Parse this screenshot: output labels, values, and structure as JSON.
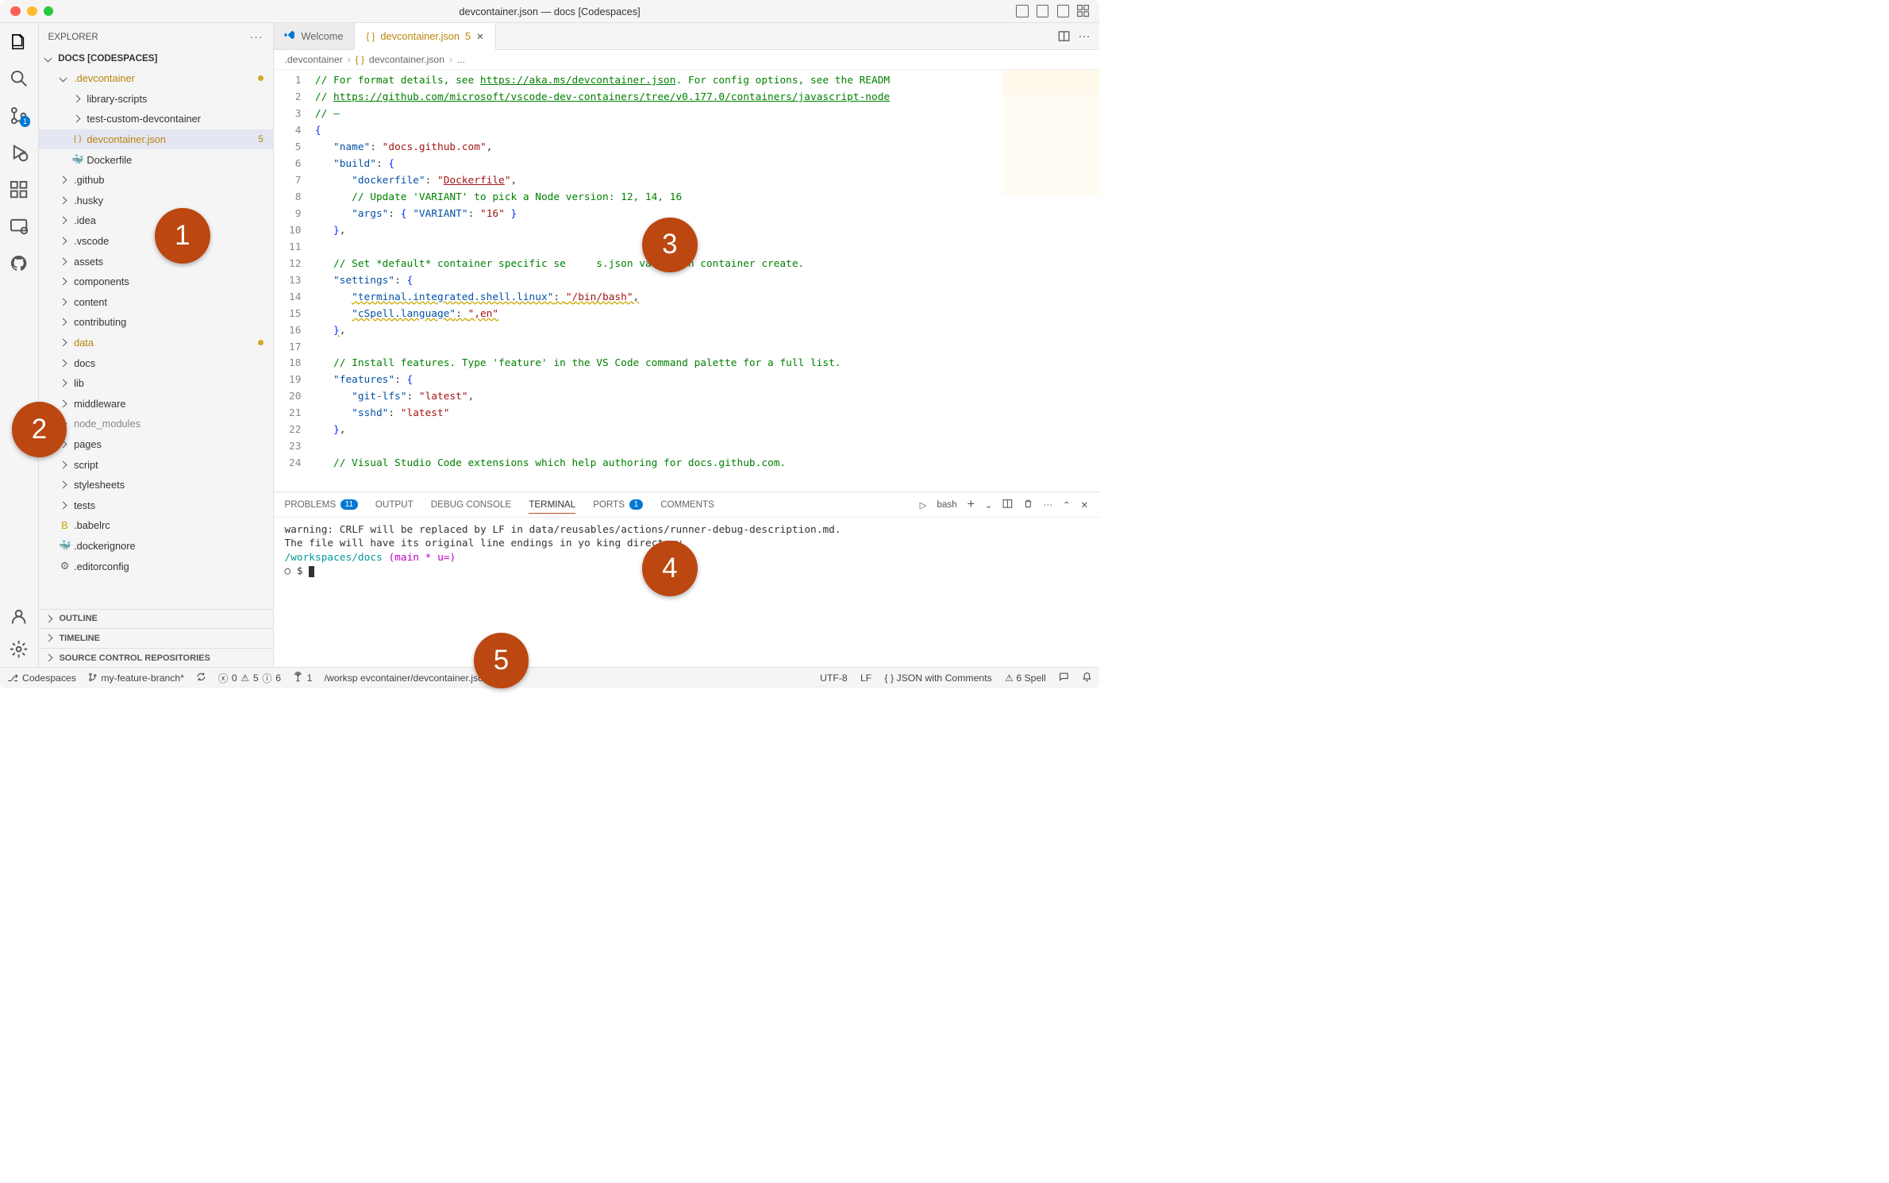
{
  "titlebar": {
    "title": "devcontainer.json — docs [Codespaces]"
  },
  "sidebar": {
    "header": "EXPLORER",
    "workspace": "DOCS [CODESPACES]",
    "tree": [
      {
        "depth": 1,
        "type": "folder-open",
        "label": ".devcontainer",
        "modified": true,
        "dot": true
      },
      {
        "depth": 2,
        "type": "folder",
        "label": "library-scripts"
      },
      {
        "depth": 2,
        "type": "folder",
        "label": "test-custom-devcontainer"
      },
      {
        "depth": 2,
        "type": "json",
        "label": "devcontainer.json",
        "modified": true,
        "selected": true,
        "badge": "5"
      },
      {
        "depth": 2,
        "type": "docker",
        "label": "Dockerfile"
      },
      {
        "depth": 1,
        "type": "folder",
        "label": ".github"
      },
      {
        "depth": 1,
        "type": "folder",
        "label": ".husky"
      },
      {
        "depth": 1,
        "type": "folder",
        "label": ".idea"
      },
      {
        "depth": 1,
        "type": "folder",
        "label": ".vscode"
      },
      {
        "depth": 1,
        "type": "folder",
        "label": "assets"
      },
      {
        "depth": 1,
        "type": "folder",
        "label": "components"
      },
      {
        "depth": 1,
        "type": "folder",
        "label": "content"
      },
      {
        "depth": 1,
        "type": "folder",
        "label": "contributing"
      },
      {
        "depth": 1,
        "type": "folder",
        "label": "data",
        "modified": true,
        "dot": true
      },
      {
        "depth": 1,
        "type": "folder",
        "label": "docs"
      },
      {
        "depth": 1,
        "type": "folder",
        "label": "lib"
      },
      {
        "depth": 1,
        "type": "folder",
        "label": "middleware"
      },
      {
        "depth": 1,
        "type": "folder",
        "label": "node_modules",
        "dimmed": true
      },
      {
        "depth": 1,
        "type": "folder",
        "label": "pages"
      },
      {
        "depth": 1,
        "type": "folder",
        "label": "script"
      },
      {
        "depth": 1,
        "type": "folder",
        "label": "stylesheets"
      },
      {
        "depth": 1,
        "type": "folder",
        "label": "tests"
      },
      {
        "depth": 1,
        "type": "babel",
        "label": ".babelrc"
      },
      {
        "depth": 1,
        "type": "docker",
        "label": ".dockerignore"
      },
      {
        "depth": 1,
        "type": "file",
        "label": ".editorconfig"
      }
    ],
    "panels": [
      "OUTLINE",
      "TIMELINE",
      "SOURCE CONTROL REPOSITORIES"
    ]
  },
  "tabs": {
    "items": [
      {
        "icon": "vscode",
        "label": "Welcome",
        "active": false
      },
      {
        "icon": "json",
        "label": "devcontainer.json",
        "badge": "5",
        "active": true,
        "close": true
      }
    ]
  },
  "breadcrumbs": {
    "items": [
      ".devcontainer",
      "devcontainer.json",
      "..."
    ]
  },
  "editor": {
    "lines": [
      {
        "n": 1,
        "html": "<span class='c-comment'>// For format details, see <span class='c-link'>https://aka.ms/devcontainer.json</span>. For config options, see the READM</span>"
      },
      {
        "n": 2,
        "html": "<span class='c-comment'>// <span class='c-link'>https://github.com/microsoft/vscode-dev-containers/tree/v0.177.0/containers/javascript-node</span></span>"
      },
      {
        "n": 3,
        "html": "<span class='c-comment'>// —</span>"
      },
      {
        "n": 4,
        "html": "<span class='c-brace'>{</span>"
      },
      {
        "n": 5,
        "html": "   <span class='c-key'>\"name\"</span>: <span class='c-string'>\"docs.github.com\"</span>,"
      },
      {
        "n": 6,
        "html": "   <span class='c-key'>\"build\"</span>: <span class='c-brace'>{</span>"
      },
      {
        "n": 7,
        "html": "      <span class='c-key'>\"dockerfile\"</span>: <span class='c-string'>\"<u>Dockerfile</u>\"</span>,"
      },
      {
        "n": 8,
        "html": "      <span class='c-comment'>// Update 'VARIANT' to pick a Node version: 12, 14, 16</span>"
      },
      {
        "n": 9,
        "html": "      <span class='c-key'>\"args\"</span>: <span class='c-brace'>{</span> <span class='c-key'>\"VARIANT\"</span>: <span class='c-string'>\"16\"</span> <span class='c-brace'>}</span>"
      },
      {
        "n": 10,
        "html": "   <span class='c-brace'>}</span>,"
      },
      {
        "n": 11,
        "html": ""
      },
      {
        "n": 12,
        "html": "   <span class='c-comment'>// Set *default* container specific se     s.json values on container create.</span>"
      },
      {
        "n": 13,
        "html": "   <span class='c-key'>\"settings\"</span>: <span class='c-brace'>{</span>"
      },
      {
        "n": 14,
        "html": "      <span class='wavy'><span class='c-key'>\"terminal.integrated.shell.linux\"</span>: <span class='c-string'>\"/bin/bash\"</span>,</span>"
      },
      {
        "n": 15,
        "html": "      <span class='wavy'><span class='c-key'>\"cSpell.language\"</span>: <span class='c-string'>\",en\"</span></span>"
      },
      {
        "n": 16,
        "html": "   <span class='c-brace wavy'>}</span>,"
      },
      {
        "n": 17,
        "html": ""
      },
      {
        "n": 18,
        "html": "   <span class='c-comment'>// Install features. Type 'feature' in the VS Code command palette for a full list.</span>"
      },
      {
        "n": 19,
        "html": "   <span class='c-key'>\"features\"</span>: <span class='c-brace'>{</span>"
      },
      {
        "n": 20,
        "html": "      <span class='c-key'>\"git-lfs\"</span>: <span class='c-string'>\"latest\"</span>,"
      },
      {
        "n": 21,
        "html": "      <span class='c-key'>\"sshd\"</span>: <span class='c-string'>\"latest\"</span>"
      },
      {
        "n": 22,
        "html": "   <span class='c-brace'>}</span>,"
      },
      {
        "n": 23,
        "html": ""
      },
      {
        "n": 24,
        "html": "   <span class='c-comment'>// Visual Studio Code extensions which help authoring for docs.github.com.</span>"
      }
    ]
  },
  "panel": {
    "tabs": {
      "problems": {
        "label": "PROBLEMS",
        "count": "11"
      },
      "output": {
        "label": "OUTPUT"
      },
      "debug": {
        "label": "DEBUG CONSOLE"
      },
      "terminal": {
        "label": "TERMINAL"
      },
      "ports": {
        "label": "PORTS",
        "count": "1"
      },
      "comments": {
        "label": "COMMENTS"
      }
    },
    "shell_label": "bash",
    "terminal_lines": {
      "l1": "warning: CRLF will be replaced by LF in data/reusables/actions/runner-debug-description.md.",
      "l2": "The file will have its original line endings in yo     king directory",
      "path": "/workspaces/docs",
      "branch": "  (main * u=)",
      "prompt": "○ $ "
    }
  },
  "statusbar": {
    "codespaces": "Codespaces",
    "branch": "my-feature-branch*",
    "errors": "0",
    "warnings": "5",
    "info": "6",
    "port_fwd": "1",
    "file_path": "/worksp           evcontainer/devcontainer.json",
    "encoding": "UTF-8",
    "eol": "LF",
    "lang": "JSON with Comments",
    "spell": "6 Spell"
  },
  "callouts": {
    "c1": "1",
    "c2": "2",
    "c3": "3",
    "c4": "4",
    "c5": "5"
  }
}
